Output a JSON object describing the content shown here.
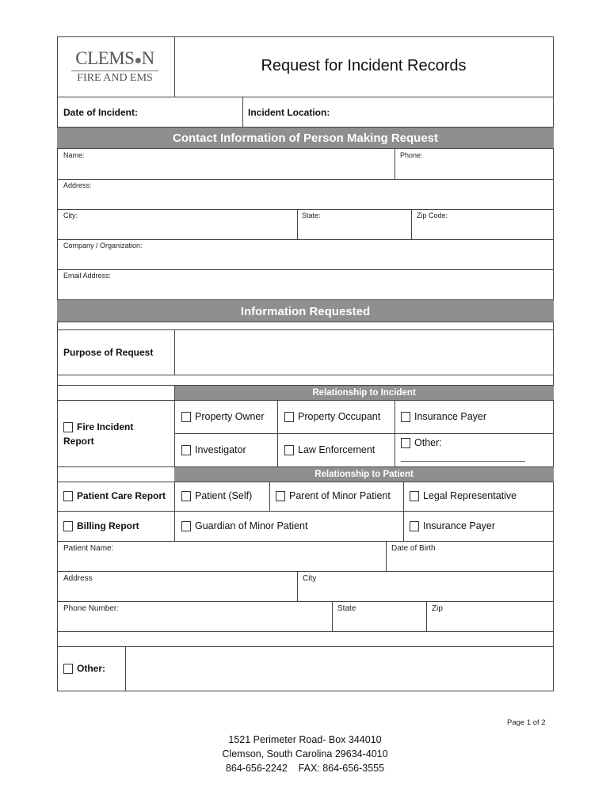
{
  "logo": {
    "line1": "CLEMS",
    "paw": "🐾",
    "line1_end": "N",
    "line2": "FIRE AND EMS"
  },
  "title": "Request for Incident Records",
  "incident": {
    "date_label": "Date of Incident:",
    "location_label": "Incident Location:"
  },
  "contact": {
    "header": "Contact Information of Person Making Request",
    "name": "Name:",
    "phone": "Phone:",
    "address": "Address:",
    "city": "City:",
    "state": "State:",
    "zip": "Zip Code:",
    "company": "Company / Organization:",
    "email": "Email Address:"
  },
  "info": {
    "header": "Information Requested",
    "purpose": "Purpose of Request"
  },
  "incident_rel": {
    "header": "Relationship to Incident",
    "report_label": "Fire Incident Report",
    "options": [
      "Property Owner",
      "Property Occupant",
      "Insurance Payer",
      "Investigator",
      "Law Enforcement",
      "Other:"
    ]
  },
  "patient_rel": {
    "header": "Relationship to Patient",
    "pcr_label": "Patient Care Report",
    "billing_label": "Billing Report",
    "options": [
      "Patient (Self)",
      "Parent of Minor Patient",
      "Legal Representative",
      "Guardian of Minor Patient",
      "Insurance Payer"
    ]
  },
  "patient": {
    "name": "Patient Name:",
    "dob": "Date of Birth",
    "address": "Address",
    "city": "City",
    "phone": "Phone Number:",
    "state": "State",
    "zip": "Zip"
  },
  "other_label": "Other:",
  "page": "Page 1 of 2",
  "footer": {
    "line1": "1521 Perimeter Road- Box 344010",
    "line2": "Clemson, South Carolina 29634-4010",
    "line3": "864-656-2242    FAX: 864-656-3555"
  }
}
